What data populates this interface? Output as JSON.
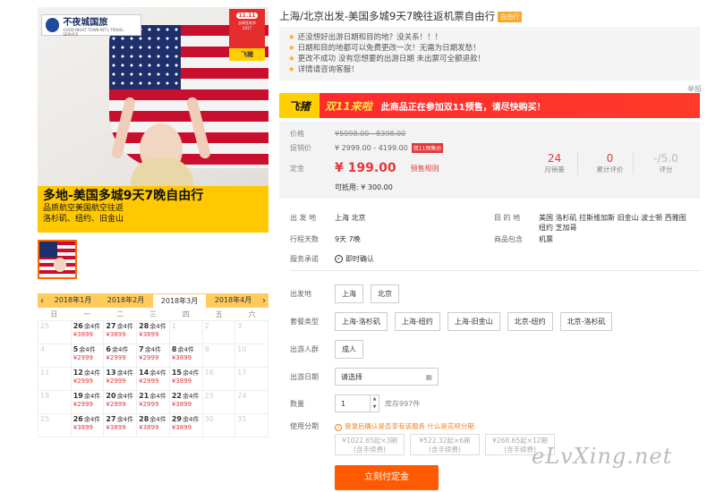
{
  "brand": {
    "logo_cn": "不夜城国旅",
    "logo_en": "GOOD NIGHT TOWN INT'L TRAVEL SERVICE",
    "badge_num": "11.11",
    "badge_line1": "全球狂欢节",
    "badge_line2": "2017",
    "badge_fz": "飞猪"
  },
  "hero": {
    "caption_title": "多地-美国多城9天7晚自由行",
    "caption_line1": "品质航空美国航空往返",
    "caption_line2": "洛杉矶、纽约、旧金山"
  },
  "calendar": {
    "prev": "‹",
    "next": "›",
    "tabs": [
      "2018年1月",
      "2018年2月",
      "2018年3月",
      "2018年4月"
    ],
    "active_tab": 2,
    "weekdays": [
      "日",
      "一",
      "二",
      "三",
      "四",
      "五",
      "六"
    ],
    "rows": [
      [
        {
          "d": "25"
        },
        {
          "d": "26",
          "s": "余4件",
          "p": "¥3899"
        },
        {
          "d": "27",
          "s": "余4件",
          "p": "¥3899"
        },
        {
          "d": "28",
          "s": "余4件",
          "p": "¥3899"
        },
        {
          "d": "1"
        },
        {
          "d": "2"
        },
        {
          "d": "3"
        }
      ],
      [
        {
          "d": "4"
        },
        {
          "d": "5",
          "s": "余4件",
          "p": "¥2999"
        },
        {
          "d": "6",
          "s": "余4件",
          "p": "¥2999"
        },
        {
          "d": "7",
          "s": "余4件",
          "p": "¥2999"
        },
        {
          "d": "8",
          "s": "余4件",
          "p": "¥3899"
        },
        {
          "d": "9"
        },
        {
          "d": "10"
        }
      ],
      [
        {
          "d": "11"
        },
        {
          "d": "12",
          "s": "余4件",
          "p": "¥2999"
        },
        {
          "d": "13",
          "s": "余4件",
          "p": "¥2999"
        },
        {
          "d": "14",
          "s": "余4件",
          "p": "¥2999"
        },
        {
          "d": "15",
          "s": "余4件",
          "p": "¥3899"
        },
        {
          "d": "16"
        },
        {
          "d": "17"
        }
      ],
      [
        {
          "d": "18"
        },
        {
          "d": "19",
          "s": "余4件",
          "p": "¥2999"
        },
        {
          "d": "20",
          "s": "余4件",
          "p": "¥2999"
        },
        {
          "d": "21",
          "s": "余4件",
          "p": "¥2999"
        },
        {
          "d": "22",
          "s": "余4件",
          "p": "¥3899"
        },
        {
          "d": "23"
        },
        {
          "d": "24"
        }
      ],
      [
        {
          "d": "25"
        },
        {
          "d": "26",
          "s": "余4件",
          "p": "¥3899"
        },
        {
          "d": "27",
          "s": "余4件",
          "p": "¥3899"
        },
        {
          "d": "28",
          "s": "余4件",
          "p": "¥3899"
        },
        {
          "d": "29",
          "s": "余4件",
          "p": "¥3899"
        },
        {
          "d": "30"
        },
        {
          "d": "31"
        }
      ]
    ]
  },
  "product": {
    "title": "上海/北京出发-美国多城9天7晚往返机票自由行",
    "title_tag": "自由行",
    "notes": [
      "还没想好出游日期和目的地？没关系！！！",
      "日期和目的地都可以免费更改一次！无需为日期发愁！",
      "更改不成功 没有您想要的出游日期 未出票可全额退款！",
      "详情请咨询客服！"
    ],
    "report": "举报",
    "banner_fz": "飞猪",
    "banner_dbl": "双11来啦",
    "banner_msg": "此商品正在参加双11预售，请尽快购买！"
  },
  "price": {
    "orig_label": "价格",
    "orig_value": "¥5998.00 - 8398.00",
    "promo_label": "促销价",
    "promo_value": "¥ 2999.00 - 4199.00",
    "promo_tag": "双11预售价",
    "deposit_label": "定金",
    "deposit_value": "¥ 199.00",
    "deposit_rule": "预售规则",
    "deduct": "可抵用: ¥ 300.00"
  },
  "stats": [
    {
      "n": "24",
      "l": "月销量"
    },
    {
      "n": "0",
      "l": "累计评价"
    },
    {
      "n": "-/5.0",
      "l": "评分"
    }
  ],
  "info": {
    "depart_label": "出 发 地",
    "depart_value": "上海  北京",
    "dest_label": "目 的 地",
    "dest_value": "美国  洛杉矶  拉斯维加斯  旧金山  波士顿  西雅图  纽约  芝加哥",
    "days_label": "行程天数",
    "days_value": "9天  7晚",
    "include_label": "商品包含",
    "include_value": "机票",
    "promise_label": "服务承诺",
    "promise_value": "即时确认"
  },
  "options": {
    "depart_label": "出发地",
    "depart": [
      "上海",
      "北京"
    ],
    "package_label": "套餐类型",
    "package": [
      "上海-洛杉矶",
      "上海-纽约",
      "上海-旧金山",
      "北京-纽约",
      "北京-洛杉矶"
    ],
    "people_label": "出游人群",
    "people": [
      "成人"
    ],
    "date_label": "出游日期",
    "date_placeholder": "请选择",
    "qty_label": "数量",
    "qty_value": "1",
    "qty_stock": "库存997件",
    "inst_label": "使用分期",
    "inst_notice": "登录后确认是否享有该服务",
    "inst_link": "什么是花呗分期",
    "inst_plans": [
      {
        "a": "¥1022.65起×3期",
        "b": "(含手续费)"
      },
      {
        "a": "¥522.32起×6期",
        "b": "(含手续费)"
      },
      {
        "a": "¥268.65起×12期",
        "b": "(含手续费)"
      }
    ],
    "buy": "立刻付定金"
  },
  "watermark": "eLvXing.net"
}
